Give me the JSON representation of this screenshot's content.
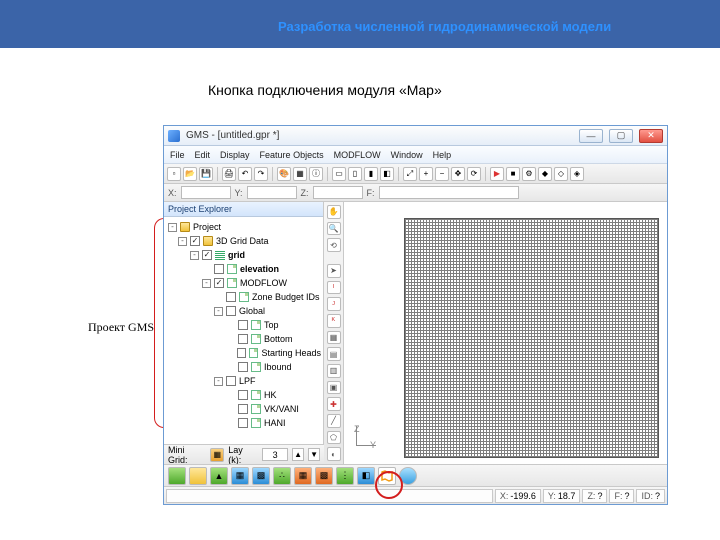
{
  "slide": {
    "header": "Разработка численной гидродинамической модели",
    "caption": "Кнопка подключения модуля «Map»",
    "brace_label": "Проект GMS"
  },
  "window": {
    "title": "GMS - [untitled.gpr *]",
    "buttons": {
      "min": "—",
      "max": "▢",
      "close": "✕"
    }
  },
  "menu": [
    "File",
    "Edit",
    "Display",
    "Feature Objects",
    "MODFLOW",
    "Window",
    "Help"
  ],
  "coord_labels": {
    "x": "X:",
    "y": "Y:",
    "z": "Z:",
    "f": "F:"
  },
  "explorer": {
    "title": "Project Explorer",
    "tree": [
      {
        "level": 0,
        "exp": "-",
        "label": "Project",
        "icon": "folder"
      },
      {
        "level": 1,
        "exp": "-",
        "cb": true,
        "label": "3D Grid Data",
        "icon": "folder"
      },
      {
        "level": 2,
        "exp": "-",
        "cb": true,
        "label": "grid",
        "icon": "grid",
        "bold": true
      },
      {
        "level": 3,
        "exp": "",
        "cb": false,
        "label": "elevation",
        "icon": "sheet",
        "bold": true
      },
      {
        "level": 3,
        "exp": "-",
        "cb": true,
        "label": "MODFLOW",
        "icon": "sheet"
      },
      {
        "level": 4,
        "exp": "",
        "cb": false,
        "label": "Zone Budget IDs",
        "icon": "sheet"
      },
      {
        "level": 4,
        "exp": "-",
        "cb": false,
        "label": "Global",
        "icon": ""
      },
      {
        "level": 5,
        "exp": "",
        "cb": false,
        "label": "Top",
        "icon": "sheet"
      },
      {
        "level": 5,
        "exp": "",
        "cb": false,
        "label": "Bottom",
        "icon": "sheet"
      },
      {
        "level": 5,
        "exp": "",
        "cb": false,
        "label": "Starting Heads",
        "icon": "sheet"
      },
      {
        "level": 5,
        "exp": "",
        "cb": false,
        "label": "Ibound",
        "icon": "sheet"
      },
      {
        "level": 4,
        "exp": "-",
        "cb": false,
        "label": "LPF",
        "icon": ""
      },
      {
        "level": 5,
        "exp": "",
        "cb": false,
        "label": "HK",
        "icon": "sheet"
      },
      {
        "level": 5,
        "exp": "",
        "cb": false,
        "label": "VK/VANI",
        "icon": "sheet"
      },
      {
        "level": 5,
        "exp": "",
        "cb": false,
        "label": "HANI",
        "icon": "sheet"
      }
    ]
  },
  "minigrid": {
    "label": "Mini Grid:",
    "lay_label": "Lay (k):",
    "lay_value": "3"
  },
  "axis": {
    "z": "Z",
    "y": "Y"
  },
  "status": {
    "x": {
      "label": "X:",
      "value": "-199.6"
    },
    "y": {
      "label": "Y:",
      "value": "18.7"
    },
    "z": {
      "label": "Z:",
      "value": "?"
    },
    "f": {
      "label": "F:",
      "value": "?"
    },
    "id": {
      "label": "ID:",
      "value": "?"
    }
  }
}
